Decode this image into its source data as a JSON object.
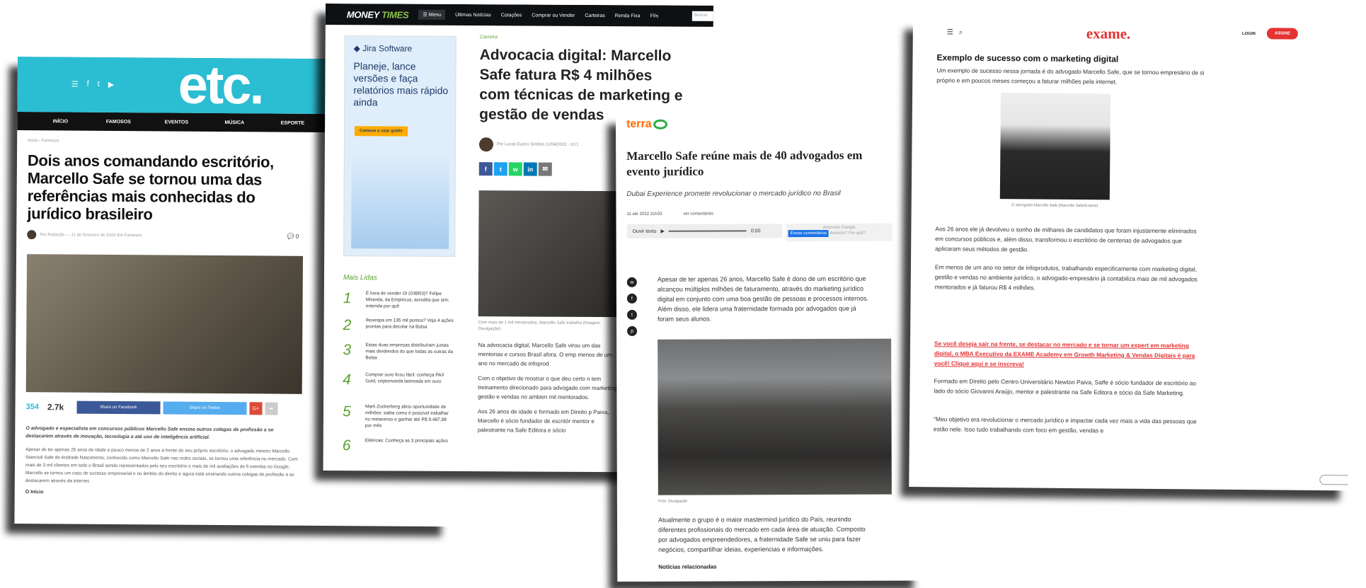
{
  "etc": {
    "logo": "etc.",
    "nav": [
      "INÍCIO",
      "FAMOSOS",
      "EVENTOS",
      "MÚSICA",
      "ESPORTE"
    ],
    "breadcrumb": "Início › Famosos",
    "title": "Dois anos comandando escritório, Marcello Safe se tornou uma das referências mais conhecidas do jurídico brasileiro",
    "meta": "Por Redação — 11 de fevereiro de 2022  Em Famosos",
    "comments": "0",
    "share_count": "354",
    "views": "2.7k",
    "facebook_btn": "Share on Facebook",
    "twitter_btn": "Share on Twitter",
    "lead": "O advogado e especialista em concursos públicos Marcello Safe ensina outros colegas de profissão a se destacarem através de inovação, tecnologia e até uso de inteligência artificial.",
    "body": "Apesar de ter apenas 25 anos de idade e pouco menos de 2 anos à frente do seu próprio escritório, o advogado mineiro Marcello Stancioli Safe de Andrade Nascimento, conhecido como Marcello Safe nas redes sociais, se tornou uma referência no mercado. Com mais de 3 mil clientes em todo o Brasil sendo representados pelo seu escritório e mais de mil avaliações de 5 estrelas no Google, Marcello se tornou um caso de sucesso empresarial e no âmbito do direito e agora está ensinando outros colegas de profissão a se destacarem através da internet.",
    "inicio": "O Início"
  },
  "mt": {
    "logo_a": "MONEY",
    "logo_b": "TIMES",
    "menu": "☰ Menu",
    "nav": [
      "Últimas Notícias",
      "Cotações",
      "Comprar ou Vender",
      "Carteiras",
      "Renda Fixa",
      "FIIs"
    ],
    "search": "Buscar",
    "ad_brand": "◆ Jira Software",
    "ad_text": "Planeje, lance versões e faça relatórios mais rápido ainda",
    "ad_btn": "Comece a usar grátis",
    "category": "Carreira",
    "title": "Advocacia digital: Marcello Safe fatura R$ 4 milhões com técnicas de marketing e gestão de vendas",
    "byline": "Por Lucas Eurico Simões   11/04/2022 - 10:1",
    "caption": "Com mais de 1 mil mentorados, Marcello Safe trabalha (Imagem: Divulgação)",
    "body1": "Na advocacia digital, Marcello Safe virou um das mentorias e cursos Brasil afora. O emp menos de um ano no mercado de infoprod",
    "body2": "Com o objetivo de mostrar o que deu certo n tem treinamento direcionado para advogado com marketing, gestão e vendas no ambien mil mentorados.",
    "body3": "Aos 26 anos de idade e formado em Direito p Paiva, Marcello é sócio fundador de escritór mentor e palestrante na Safe Editora e sócio",
    "mais_lidas": "Mais Lidas",
    "mais": [
      {
        "n": "1",
        "t": "É hora de vender OI (OIBR3)? Felipe Miranda, da Empiricus, acredita que sim; entenda por quê"
      },
      {
        "n": "2",
        "t": "Ibovespa em 135 mil pontos? Veja 4 ações prontas para decolar na Bolsa"
      },
      {
        "n": "3",
        "t": "Estas duas empresas distribuíram juntas mais dividendos do que todas as outras da Bolsa"
      },
      {
        "n": "4",
        "t": "Comprar ouro ficou fácil: conheça PAX Gold, criptomoeda lastreada em ouro"
      },
      {
        "n": "5",
        "t": "Mark Zuckerberg abriu oportunidade de milhões: saiba como é possível trabalhar no metaverso e ganhar até R$ 9.497,98 por mês"
      },
      {
        "n": "6",
        "t": "Elétricas: Conheça as 3 principais ações"
      }
    ]
  },
  "terra": {
    "logo": "terra",
    "title": "Marcello Safe reúne mais de 40 advogados em evento jurídico",
    "subtitle": "Dubai Experience promete revolucionar o mercado jurídico no Brasil",
    "date": "11 abr 2022 21h33",
    "comments": "ver comentários",
    "audio": "Ouvir texto",
    "time": "0:00",
    "ads": "Anúncios Google",
    "ads_btn": "Enviar comentários",
    "ads_q": "Anúncio? Por quê?",
    "p1": "Apesar de ter apenas 26 anos, Marcello Safe é dono de um escritório que alcançou múltiplos milhões de faturamento, através do marketing jurídico digital em conjunto com uma boa gestão de pessoas e processos internos. Além disso, ele lidera uma fraternidade formada por advogados que já foram seus alunos.",
    "photo_credit": "Foto: Divulgação",
    "p2": "Atualmente o grupo é o maior mastermind jurídico do País, reunindo diferentes profissionais do mercado em cada área de atuação. Composto por advogados empreendedores, a fraternidade Safe se uniu para fazer negócios, compartilhar ideias, experiencias e informações.",
    "related": "Notícias relacionadas"
  },
  "exame": {
    "logo": "exame.",
    "login": "LOGIN",
    "assine": "ASSINE",
    "heading": "Exemplo de sucesso com o marketing digital",
    "p1": "Um exemplo de sucesso nessa jornada é do advogado Marcello Safe, que se tornou empresário de si próprio e em poucos meses começou a faturar milhões pela internet.",
    "photo_caption": "O advogado Marcello Safe (Marcello Safe/Exame)",
    "p2": "Aos 26 anos ele já devolveu o sonho de milhares de candidatos que foram injustamente eliminados em concursos públicos e, além disso, transformou o escritório de centenas de advogados que aplicaram seus métodos de gestão.",
    "p3": "Em menos de um ano no setor de infoprodutos, trabalhando especificamente com marketing digital, gestão e vendas no ambiente jurídico, o advogado-empresário já contabiliza mais de mil advogados mentorados e já faturou R$ 4 milhões.",
    "cta": "Se você deseja sair na frente, se destacar no mercado e se tornar um expert em marketing digital, o MBA Executivo da EXAME Academy em Growth Marketing & Vendas Digitais é para você! Clique aqui e se inscreva!",
    "p4": "Formado em Direito pelo Centro Universitário Newton Paiva, Saffe é sócio fundador de escritório ao lado do sócio Giovanni Araújo, mentor e palestrante na Safe Editora e sócio da Safe Marketing.",
    "p5": "\"Meu objetivo era revolucionar o mercado jurídico e impactar cada vez mais a vida das pessoas que estão nele. Isso tudo trabalhando com foco em gestão, vendas e"
  }
}
